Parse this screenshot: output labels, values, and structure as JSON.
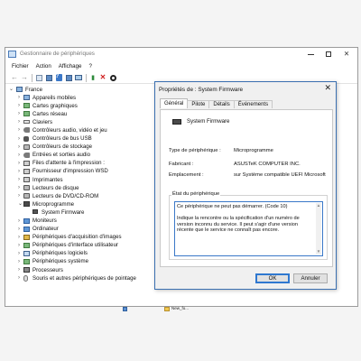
{
  "window": {
    "title": "Gestionnaire de périphériques",
    "controls": {
      "minimize": "—",
      "maximize": "☐",
      "close": "✕"
    }
  },
  "menu": [
    "Fichier",
    "Action",
    "Affichage",
    "?"
  ],
  "toolbar": {
    "icons": [
      "back-arrow-icon",
      "forward-arrow-icon",
      "properties-icon",
      "show-hidden-icon",
      "help-icon",
      "show-pane-icon",
      "scan-hardware-icon",
      "update-driver-icon",
      "uninstall-icon",
      "download-icon"
    ]
  },
  "tree": {
    "root": "France",
    "items": [
      {
        "label": "Appareils mobiles",
        "icon": "pc-icon"
      },
      {
        "label": "Cartes graphiques",
        "icon": "card-icon"
      },
      {
        "label": "Cartes réseau",
        "icon": "card-icon"
      },
      {
        "label": "Claviers",
        "icon": "keyboard-icon"
      },
      {
        "label": "Contrôleurs audio, vidéo et jeu",
        "icon": "sound-icon"
      },
      {
        "label": "Contrôleurs de bus USB",
        "icon": "usb-icon"
      },
      {
        "label": "Contrôleurs de stockage",
        "icon": "disk-icon"
      },
      {
        "label": "Entrées et sorties audio",
        "icon": "sound-icon"
      },
      {
        "label": "Files d'attente à l'impression :",
        "icon": "print-icon"
      },
      {
        "label": "Fournisseur d'impression WSD",
        "icon": "print-icon"
      },
      {
        "label": "Imprimantes",
        "icon": "print-icon"
      },
      {
        "label": "Lecteurs de disque",
        "icon": "disk-icon"
      },
      {
        "label": "Lecteurs de DVD/CD-ROM",
        "icon": "disk-icon"
      },
      {
        "label": "Microprogramme",
        "icon": "chip-icon",
        "expanded": true
      },
      {
        "label": "System Firmware",
        "icon": "chip-icon",
        "child": true
      },
      {
        "label": "Moniteurs",
        "icon": "monitor-icon"
      },
      {
        "label": "Ordinateur",
        "icon": "monitor-icon"
      },
      {
        "label": "Périphériques d'acquisition d'images",
        "icon": "sec-icon"
      },
      {
        "label": "Périphériques d'interface utilisateur",
        "icon": "card-icon"
      },
      {
        "label": "Périphériques logiciels",
        "icon": "soft-icon"
      },
      {
        "label": "Périphériques système",
        "icon": "card-icon"
      },
      {
        "label": "Processeurs",
        "icon": "proc-icon"
      },
      {
        "label": "Souris et autres périphériques de pointage",
        "icon": "mouse-icon"
      }
    ]
  },
  "dialog": {
    "title": "Propriétés de : System Firmware",
    "close": "✕",
    "tabs": [
      "Général",
      "Pilote",
      "Détails",
      "Événements"
    ],
    "active_tab": "Général",
    "device_name": "System Firmware",
    "properties": [
      {
        "label": "Type de périphérique :",
        "value": "Microprogramme"
      },
      {
        "label": "Fabricant :",
        "value": "ASUSTeK COMPUTER INC."
      },
      {
        "label": "Emplacement :",
        "value": "sur Système compatible UEFI Microsoft"
      }
    ],
    "status_legend": "État du périphérique",
    "status_line": "Ce périphérique ne peut pas démarrer. (Code 10)",
    "status_desc": "Indique la rencontre ou la spécification d'un numéro de version inconnu du service. Il peut s'agir d'une version récente que le service ne connaît pas encore.",
    "ok_label": "OK",
    "cancel_label": "Annuler"
  },
  "taskbar": {
    "item_label": "New_fo..."
  }
}
